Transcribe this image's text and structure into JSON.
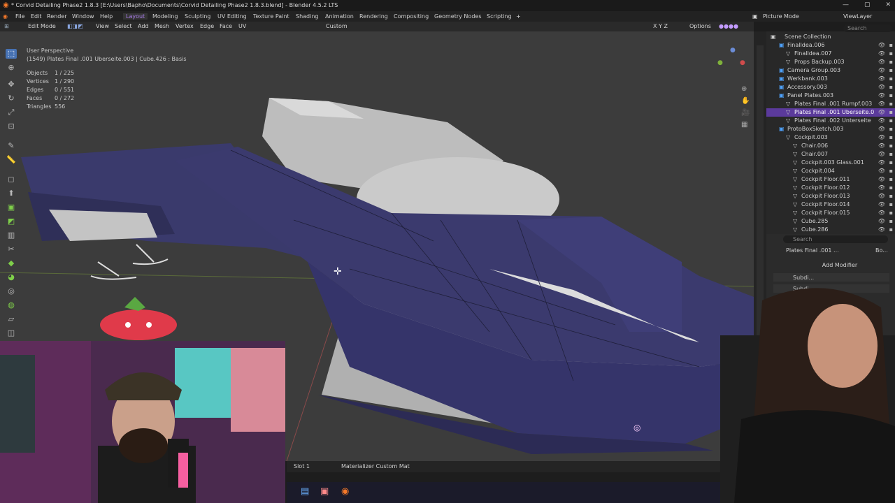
{
  "window": {
    "title": "* Corvid Detailing Phase2 1.8.3 [E:\\Users\\Bapho\\Documents\\Corvid Detailing Phase2 1.8.3.blend] - Blender 4.5.2 LTS",
    "controls": [
      "—",
      "▢",
      "✕"
    ]
  },
  "menu": {
    "items": [
      "File",
      "Edit",
      "Render",
      "Window",
      "Help"
    ],
    "workspaces": [
      "Layout",
      "Modeling",
      "Sculpting",
      "UV Editing",
      "Texture Paint",
      "Shading",
      "Animation",
      "Rendering",
      "Compositing",
      "Geometry Nodes",
      "Scripting",
      "+"
    ],
    "active_workspace": "Layout",
    "scene_mode": "Picture Mode",
    "view_layer": "ViewLayer"
  },
  "toolbar": {
    "mode": "Edit Mode",
    "menus": [
      "View",
      "Select",
      "Add",
      "Mesh",
      "Vertex",
      "Edge",
      "Face",
      "UV"
    ],
    "transform": "Custom",
    "axes": "X Y Z",
    "options": "Options",
    "search_placeholder": "Search"
  },
  "viewport": {
    "perspective": "User Perspective",
    "object": "(1549) Plates Final .001 Uberseite.003 | Cube.426 : Basis",
    "stats": [
      {
        "label": "Objects",
        "value": "1 / 225"
      },
      {
        "label": "Vertices",
        "value": "1 / 290"
      },
      {
        "label": "Edges",
        "value": "0 / 551"
      },
      {
        "label": "Faces",
        "value": "0 / 272"
      },
      {
        "label": "Triangles",
        "value": "556"
      }
    ]
  },
  "outliner": {
    "title": "Scene Collection",
    "rows": [
      {
        "label": "FinalIdea.006",
        "indent": 1,
        "selected": false
      },
      {
        "label": "FinalIdea.007",
        "indent": 2,
        "selected": false
      },
      {
        "label": "Props Backup.003",
        "indent": 2,
        "selected": false
      },
      {
        "label": "Camera Group.003",
        "indent": 1,
        "selected": false
      },
      {
        "label": "Werkbank.003",
        "indent": 1,
        "selected": false
      },
      {
        "label": "Accessory.003",
        "indent": 1,
        "selected": false
      },
      {
        "label": "Panel Plates.003",
        "indent": 1,
        "selected": false
      },
      {
        "label": "Plates Final .001 Rumpf.003",
        "indent": 2,
        "selected": false
      },
      {
        "label": "Plates Final .001 Uberseite.0",
        "indent": 2,
        "selected": true
      },
      {
        "label": "Plates Final .002 Unterseite",
        "indent": 2,
        "selected": false
      },
      {
        "label": "ProtoBoxSketch.003",
        "indent": 1,
        "selected": false
      },
      {
        "label": "Cockpit.003",
        "indent": 2,
        "selected": false
      },
      {
        "label": "Chair.006",
        "indent": 3,
        "selected": false
      },
      {
        "label": "Chair.007",
        "indent": 3,
        "selected": false
      },
      {
        "label": "Cockpit.003 Glass.001",
        "indent": 3,
        "selected": false
      },
      {
        "label": "Cockpit.004",
        "indent": 3,
        "selected": false
      },
      {
        "label": "Cockpit Floor.011",
        "indent": 3,
        "selected": false
      },
      {
        "label": "Cockpit Floor.012",
        "indent": 3,
        "selected": false
      },
      {
        "label": "Cockpit Floor.013",
        "indent": 3,
        "selected": false
      },
      {
        "label": "Cockpit Floor.014",
        "indent": 3,
        "selected": false
      },
      {
        "label": "Cockpit Floor.015",
        "indent": 3,
        "selected": false
      },
      {
        "label": "Cube.285",
        "indent": 3,
        "selected": false
      },
      {
        "label": "Cube.286",
        "indent": 3,
        "selected": false
      }
    ]
  },
  "properties": {
    "search_placeholder": "Search",
    "object_name": "Plates Final .001 ...",
    "tab2": "Bo...",
    "add_modifier": "Add Modifier",
    "modifiers": [
      "Subdi...",
      "Subdi..."
    ]
  },
  "bottom": {
    "slot": "Slot 1",
    "material": "Materializer Custom Mat"
  },
  "colors": {
    "accent": "#5b3a9c",
    "hull": "#3b3a6e",
    "hull_light": "#b7b7b7",
    "viewport_bg": "#3c3c3c",
    "workspace_active": "#a77be6"
  },
  "icons": {
    "logo": "blender-icon",
    "cursor": "crosshair-cursor-icon",
    "3d_cursor": "3d-cursor-icon",
    "eye": "eye-icon",
    "camera": "camera-icon"
  }
}
